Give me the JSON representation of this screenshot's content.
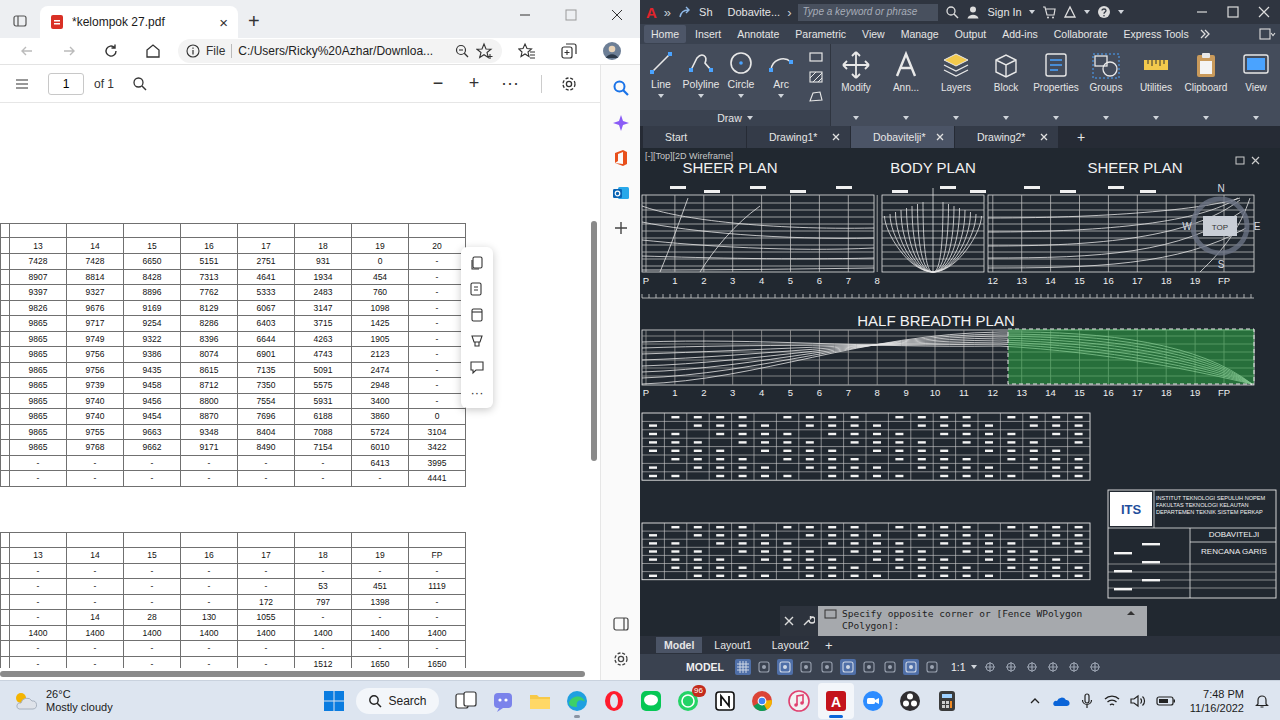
{
  "browser": {
    "tab": {
      "title": "*kelompok 27.pdf",
      "close": "×",
      "selected": true
    },
    "new_tab": "+",
    "address": {
      "scheme": "File",
      "url": "C:/Users/Ricky%20Azhar/Downloa..."
    },
    "pdf_toolbar": {
      "page": "1",
      "page_count": "of 1",
      "zoom_out": "−",
      "zoom_in": "+",
      "more": "···"
    },
    "float_toolbar": {
      "more": "···"
    },
    "tables": [
      {
        "columns": [
          "13",
          "14",
          "15",
          "16",
          "17",
          "18",
          "19",
          "20"
        ],
        "rows": [
          [
            "7428",
            "7428",
            "6650",
            "5151",
            "2751",
            "931",
            "0",
            "-"
          ],
          [
            "8907",
            "8814",
            "8428",
            "7313",
            "4641",
            "1934",
            "454",
            "-"
          ],
          [
            "9397",
            "9327",
            "8896",
            "7762",
            "5333",
            "2483",
            "760",
            "-"
          ],
          [
            "9826",
            "9676",
            "9169",
            "8129",
            "6067",
            "3147",
            "1098",
            "-"
          ],
          [
            "9865",
            "9717",
            "9254",
            "8286",
            "6403",
            "3715",
            "1425",
            "-"
          ],
          [
            "9865",
            "9749",
            "9322",
            "8396",
            "6644",
            "4263",
            "1905",
            "-"
          ],
          [
            "9865",
            "9756",
            "9386",
            "8074",
            "6901",
            "4743",
            "2123",
            "-"
          ],
          [
            "9865",
            "9756",
            "9435",
            "8615",
            "7135",
            "5091",
            "2474",
            "-"
          ],
          [
            "9865",
            "9739",
            "9458",
            "8712",
            "7350",
            "5575",
            "2948",
            "-"
          ],
          [
            "9865",
            "9740",
            "9456",
            "8800",
            "7554",
            "5931",
            "3400",
            "-"
          ],
          [
            "9865",
            "9740",
            "9454",
            "8870",
            "7696",
            "6188",
            "3860",
            "0"
          ],
          [
            "9865",
            "9755",
            "9663",
            "9348",
            "8404",
            "7088",
            "5724",
            "3104"
          ],
          [
            "9865",
            "9768",
            "9662",
            "9171",
            "8490",
            "7154",
            "6010",
            "3422"
          ],
          [
            "-",
            "-",
            "-",
            "-",
            "-",
            "-",
            "6413",
            "3995"
          ],
          [
            "-",
            "-",
            "-",
            "-",
            "-",
            "-",
            "-",
            "4441"
          ]
        ]
      },
      {
        "columns": [
          "13",
          "14",
          "15",
          "16",
          "17",
          "18",
          "19",
          "FP"
        ],
        "rows": [
          [
            "-",
            "-",
            "-",
            "-",
            "-",
            "-",
            "-",
            "-"
          ],
          [
            "-",
            "-",
            "-",
            "-",
            "-",
            "53",
            "451",
            "1119"
          ],
          [
            "-",
            "-",
            "-",
            "-",
            "172",
            "797",
            "1398",
            "-"
          ],
          [
            "-",
            "14",
            "28",
            "130",
            "1055",
            "-",
            "-",
            "-"
          ],
          [
            "1400",
            "1400",
            "1400",
            "1400",
            "1400",
            "1400",
            "1400",
            "1400"
          ],
          [
            "-",
            "-",
            "-",
            "-",
            "-",
            "-",
            "-",
            "-"
          ],
          [
            "-",
            "-",
            "-",
            "-",
            "-",
            "1512",
            "1650",
            "1650"
          ]
        ]
      }
    ]
  },
  "autocad": {
    "logo": "A",
    "overflow": "»",
    "share": "Sh",
    "title": "Dobavite...",
    "title_next": "›",
    "search": {
      "placeholder": "Type a keyword or phrase"
    },
    "sign_in": "Sign In",
    "ribbon_tabs": [
      {
        "label": "Home",
        "selected": true
      },
      {
        "label": "Insert",
        "selected": false
      },
      {
        "label": "Annotate",
        "selected": false
      },
      {
        "label": "Parametric",
        "selected": false
      },
      {
        "label": "View",
        "selected": false
      },
      {
        "label": "Manage",
        "selected": false
      },
      {
        "label": "Output",
        "selected": false
      },
      {
        "label": "Add-ins",
        "selected": false
      },
      {
        "label": "Collaborate",
        "selected": false
      },
      {
        "label": "Express Tools",
        "selected": false
      }
    ],
    "draw_tools": [
      {
        "label": "Line",
        "kind": "line"
      },
      {
        "label": "Polyline",
        "kind": "polyline"
      },
      {
        "label": "Circle",
        "kind": "circle"
      },
      {
        "label": "Arc",
        "kind": "arc"
      }
    ],
    "draw_panel": "Draw",
    "tools": [
      {
        "label": "Modify",
        "kind": "modify"
      },
      {
        "label": "Ann...",
        "kind": "annotate"
      },
      {
        "label": "Layers",
        "kind": "layers"
      },
      {
        "label": "Block",
        "kind": "block"
      },
      {
        "label": "Properties",
        "kind": "properties"
      },
      {
        "label": "Groups",
        "kind": "groups"
      },
      {
        "label": "Utilities",
        "kind": "utilities"
      },
      {
        "label": "Clipboard",
        "kind": "clipboard"
      },
      {
        "label": "View",
        "kind": "view"
      }
    ],
    "doc_tabs": [
      {
        "label": "Start",
        "selected": false,
        "closable": false
      },
      {
        "label": "Drawing1*",
        "selected": false,
        "closable": true
      },
      {
        "label": "Dobavitelji*",
        "selected": true,
        "closable": true
      },
      {
        "label": "Drawing2*",
        "selected": false,
        "closable": true
      }
    ],
    "new_doc": "+",
    "viewport_label": "[-][Top][2D Wireframe]",
    "drawing": {
      "titles": [
        "SHEER PLAN",
        "BODY PLAN",
        "SHEER PLAN"
      ],
      "half_breadth_title": "HALF BREADTH PLAN",
      "stations_top": [
        "P",
        "1",
        "2",
        "3",
        "4",
        "5",
        "6",
        "7",
        "8",
        "12",
        "13",
        "14",
        "15",
        "16",
        "17",
        "18",
        "19",
        "FP"
      ],
      "stations_half": [
        "P",
        "1",
        "2",
        "3",
        "4",
        "5",
        "6",
        "7",
        "8",
        "9",
        "10",
        "11",
        "12",
        "13",
        "14",
        "15",
        "16",
        "17",
        "18",
        "19",
        "FP"
      ],
      "compass": {
        "north": "N",
        "west": "W",
        "east": "E",
        "south": "S",
        "face": "TOP"
      },
      "title_block": {
        "logo": "ITS",
        "lines": [
          "INSTITUT TEKNOLOGI SEPULUH NOPEM",
          "FAKULTAS TEKNOLOGI KELAUTAN",
          "DEPARTEMEN TEKNIK SISTEM PERKAP"
        ],
        "name": "DOBAVITELJI",
        "drawing": "RENCANA GARIS"
      },
      "selection": {
        "active": true
      }
    },
    "command": {
      "text": "Specify opposite corner or [Fence WPolygon CPolygon]:"
    },
    "layout_tabs": [
      {
        "label": "Model",
        "selected": true
      },
      {
        "label": "Layout1",
        "selected": false
      },
      {
        "label": "Layout2",
        "selected": false
      }
    ],
    "new_layout": "+",
    "status": {
      "model": "MODEL",
      "scale": "1:1"
    }
  },
  "taskbar": {
    "weather": {
      "temp": "26°C",
      "condition": "Mostly cloudy"
    },
    "search": "Search",
    "apps": [
      {
        "kind": "taskview",
        "running": false,
        "selected": false
      },
      {
        "kind": "teams",
        "running": false,
        "selected": false
      },
      {
        "kind": "explorer",
        "running": false,
        "selected": false
      },
      {
        "kind": "edge",
        "running": true,
        "selected": false
      },
      {
        "kind": "opera",
        "running": false,
        "selected": false
      },
      {
        "kind": "line",
        "running": false,
        "selected": false
      },
      {
        "kind": "whatsapp",
        "running": false,
        "selected": false,
        "badge": "96"
      },
      {
        "kind": "notion",
        "running": false,
        "selected": false
      },
      {
        "kind": "chrome",
        "running": false,
        "selected": false
      },
      {
        "kind": "itunes",
        "running": false,
        "selected": false
      },
      {
        "kind": "autocad",
        "running": true,
        "selected": true,
        "glyph": "A"
      },
      {
        "kind": "zoom",
        "running": false,
        "selected": false
      },
      {
        "kind": "obs",
        "running": false,
        "selected": false
      },
      {
        "kind": "calculator",
        "running": false,
        "selected": false
      }
    ],
    "clock": {
      "time": "7:48 PM",
      "date": "11/16/2022"
    }
  }
}
